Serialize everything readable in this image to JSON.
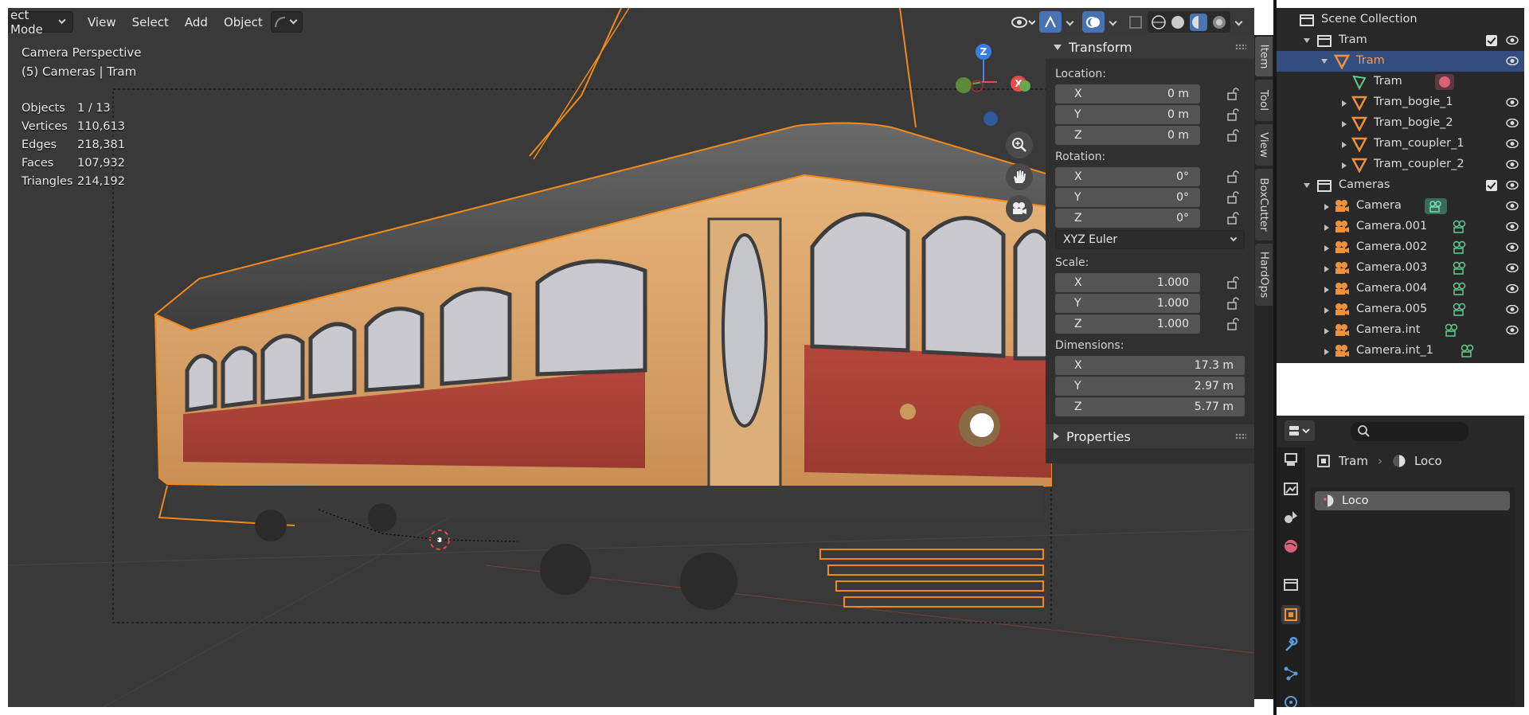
{
  "header": {
    "mode_label": "ect Mode",
    "menus": [
      "View",
      "Select",
      "Add",
      "Object"
    ]
  },
  "viewport": {
    "view_name": "Camera Perspective",
    "collection_info": "(5) Cameras | Tram",
    "stats": [
      {
        "label": "Objects",
        "value": "1 / 13"
      },
      {
        "label": "Vertices",
        "value": "110,613"
      },
      {
        "label": "Edges",
        "value": "218,381"
      },
      {
        "label": "Faces",
        "value": "107,932"
      },
      {
        "label": "Triangles",
        "value": "214,192"
      }
    ],
    "gizmo": {
      "z": "Z",
      "x": "X"
    }
  },
  "npanel": {
    "transform_title": "Transform",
    "location_label": "Location:",
    "location": [
      {
        "axis": "X",
        "value": "0 m"
      },
      {
        "axis": "Y",
        "value": "0 m"
      },
      {
        "axis": "Z",
        "value": "0 m"
      }
    ],
    "rotation_label": "Rotation:",
    "rotation": [
      {
        "axis": "X",
        "value": "0°"
      },
      {
        "axis": "Y",
        "value": "0°"
      },
      {
        "axis": "Z",
        "value": "0°"
      }
    ],
    "rotation_mode": "XYZ Euler",
    "scale_label": "Scale:",
    "scale": [
      {
        "axis": "X",
        "value": "1.000"
      },
      {
        "axis": "Y",
        "value": "1.000"
      },
      {
        "axis": "Z",
        "value": "1.000"
      }
    ],
    "dimensions_label": "Dimensions:",
    "dimensions": [
      {
        "axis": "X",
        "value": "17.3 m"
      },
      {
        "axis": "Y",
        "value": "2.97 m"
      },
      {
        "axis": "Z",
        "value": "5.77 m"
      }
    ],
    "properties_title": "Properties",
    "tabs": [
      "Item",
      "Tool",
      "View",
      "BoxCutter",
      "HardOps"
    ]
  },
  "outliner": {
    "root": "Scene Collection",
    "rows": [
      {
        "name": "Tram",
        "type": "collection"
      },
      {
        "name": "Tram",
        "type": "object",
        "selected": true
      },
      {
        "name": "Tram",
        "type": "mesh"
      },
      {
        "name": "Tram_bogie_1",
        "type": "object"
      },
      {
        "name": "Tram_bogie_2",
        "type": "object"
      },
      {
        "name": "Tram_coupler_1",
        "type": "object"
      },
      {
        "name": "Tram_coupler_2",
        "type": "object"
      },
      {
        "name": "Cameras",
        "type": "collection"
      },
      {
        "name": "Camera",
        "type": "camera"
      },
      {
        "name": "Camera.001",
        "type": "camera"
      },
      {
        "name": "Camera.002",
        "type": "camera"
      },
      {
        "name": "Camera.003",
        "type": "camera"
      },
      {
        "name": "Camera.004",
        "type": "camera"
      },
      {
        "name": "Camera.005",
        "type": "camera"
      },
      {
        "name": "Camera.int",
        "type": "camera"
      },
      {
        "name": "Camera.int_1",
        "type": "camera"
      }
    ]
  },
  "properties": {
    "breadcrumb_object": "Tram",
    "breadcrumb_material": "Loco",
    "material_slot": "Loco"
  },
  "colors": {
    "selection_orange": "#f08a1c",
    "outliner_selected": "#334d80",
    "viewport_bg": "#393939"
  }
}
